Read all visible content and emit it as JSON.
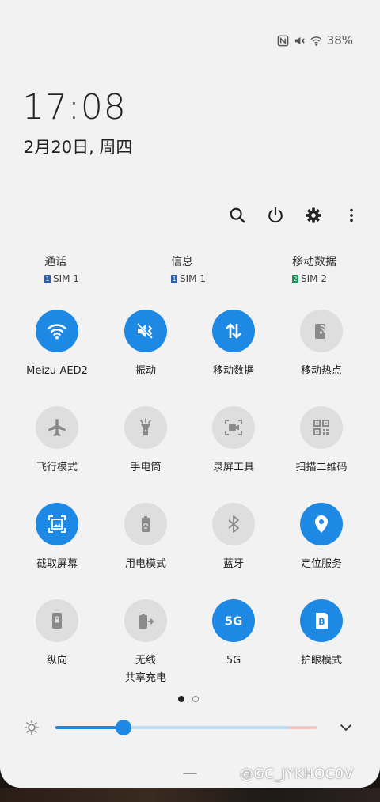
{
  "status_bar": {
    "icons": [
      "nfc-icon",
      "vibrate-icon",
      "wifi-icon"
    ],
    "battery": "38%"
  },
  "clock": {
    "time": "17:08",
    "date": "2月20日, 周四"
  },
  "toolbar": {
    "buttons": [
      "search-icon",
      "power-icon",
      "settings-icon",
      "more-icon"
    ]
  },
  "sim_cards": [
    {
      "title": "通话",
      "sim_num": "1",
      "sim": "SIM 1",
      "color": "#2c5fa8"
    },
    {
      "title": "信息",
      "sim_num": "1",
      "sim": "SIM 1",
      "color": "#2c5fa8"
    },
    {
      "title": "移动数据",
      "sim_num": "2",
      "sim": "SIM 2",
      "color": "#1e8f5a"
    }
  ],
  "tiles": [
    {
      "label": "Meizu-AED2",
      "icon": "wifi-icon",
      "on": true
    },
    {
      "label": "振动",
      "icon": "vibrate-icon",
      "on": true
    },
    {
      "label": "移动数据",
      "icon": "mobile-data-icon",
      "on": true
    },
    {
      "label": "移动热点",
      "icon": "hotspot-icon",
      "on": false
    },
    {
      "label": "飞行模式",
      "icon": "airplane-icon",
      "on": false
    },
    {
      "label": "手电筒",
      "icon": "flashlight-icon",
      "on": false
    },
    {
      "label": "录屏工具",
      "icon": "screen-record-icon",
      "on": false
    },
    {
      "label": "扫描二维码",
      "icon": "qr-code-icon",
      "on": false
    },
    {
      "label": "截取屏幕",
      "icon": "screenshot-icon",
      "on": true
    },
    {
      "label": "用电模式",
      "icon": "power-mode-icon",
      "on": false
    },
    {
      "label": "蓝牙",
      "icon": "bluetooth-icon",
      "on": false
    },
    {
      "label": "定位服务",
      "icon": "location-icon",
      "on": true
    },
    {
      "label": "纵向",
      "icon": "portrait-lock-icon",
      "on": false
    },
    {
      "label": "无线\n共享充电",
      "icon": "wireless-share-icon",
      "on": false
    },
    {
      "label": "5G",
      "icon": "5g-icon",
      "on": true
    },
    {
      "label": "护眼模式",
      "icon": "eye-comfort-icon",
      "on": true
    }
  ],
  "pager": {
    "current": 1,
    "total": 2
  },
  "brightness": {
    "level": 0.26,
    "icon": "brightness-icon"
  },
  "expand_icon": "chevron-down-icon",
  "watermark": "@GC_JYKHOC0V",
  "colors": {
    "accent": "#1e88e5",
    "tile_off": "#dedede",
    "panel": "#f2f2f2"
  }
}
